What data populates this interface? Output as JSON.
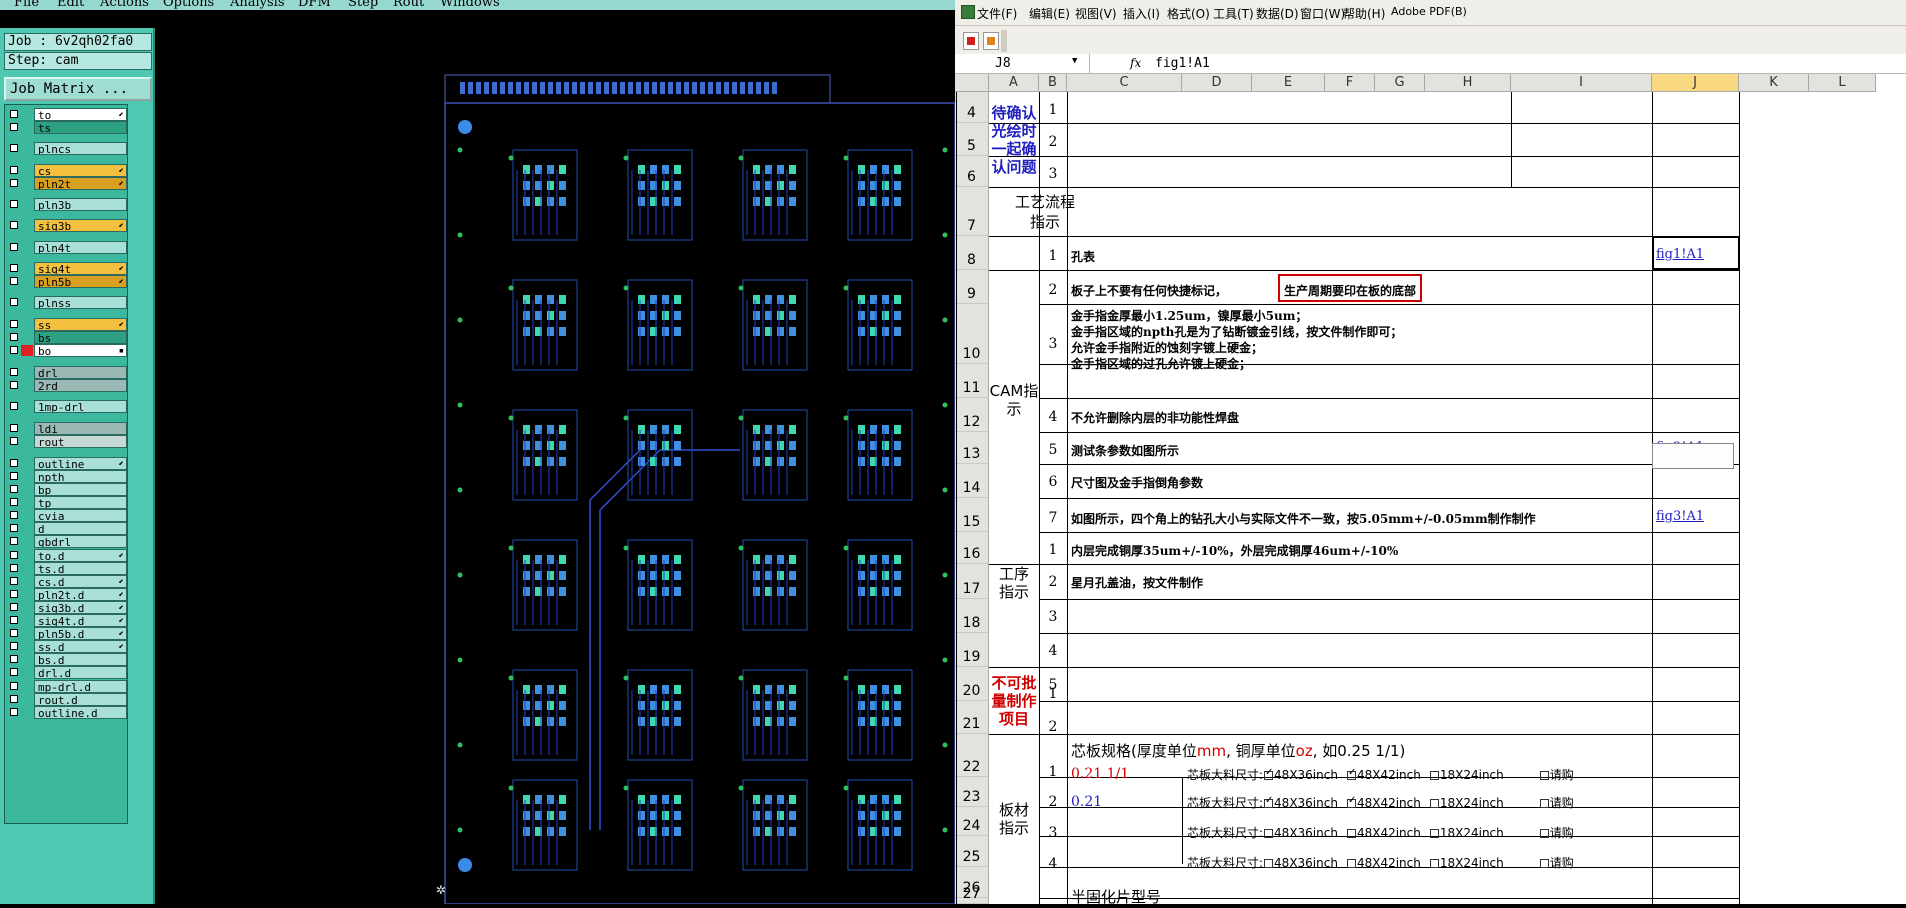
{
  "cam": {
    "menu": [
      "File",
      "Edit",
      "Actions",
      "Options",
      "Analysis",
      "DFM",
      "Step",
      "Rout",
      "Windows"
    ],
    "job_label": "Job : 6v2qh02fa0",
    "step_label": "Step: cam",
    "job_matrix_button": "Job Matrix ...",
    "layers": [
      {
        "name": "to",
        "color": "#ffffff",
        "edit": "⬋"
      },
      {
        "name": "ts",
        "color": "#2ca080",
        "edit": ""
      },
      {
        "name": "plncs",
        "color": "#a8e0d8",
        "edit": ""
      },
      {
        "name": "cs",
        "color": "#f4c040",
        "edit": "⬋"
      },
      {
        "name": "pln2t",
        "color": "#d8a020",
        "edit": "⬋"
      },
      {
        "name": "pln3b",
        "color": "#a8e0d8",
        "edit": ""
      },
      {
        "name": "sig3b",
        "color": "#f4c040",
        "edit": "⬋"
      },
      {
        "name": "pln4t",
        "color": "#a8e0d8",
        "edit": ""
      },
      {
        "name": "sig4t",
        "color": "#f4c040",
        "edit": "⬋"
      },
      {
        "name": "pln5b",
        "color": "#d8a020",
        "edit": "⬋"
      },
      {
        "name": "plnss",
        "color": "#a8e0d8",
        "edit": ""
      },
      {
        "name": "ss",
        "color": "#f4c040",
        "edit": "⬋"
      },
      {
        "name": "bs",
        "color": "#2ca080",
        "edit": ""
      },
      {
        "name": "bo",
        "color": "#ffffff",
        "edit": "▪"
      },
      {
        "name": "drl",
        "color": "#9ab8b4",
        "edit": ""
      },
      {
        "name": "2rd",
        "color": "#9ab8b4",
        "edit": ""
      },
      {
        "name": "1mp-drl",
        "color": "#a8e0d8",
        "edit": ""
      },
      {
        "name": "ldi",
        "color": "#9ab8b4",
        "edit": ""
      },
      {
        "name": "rout",
        "color": "#c8d8d4",
        "edit": ""
      },
      {
        "name": "outline",
        "color": "#a8e0d8",
        "edit": "⬋"
      },
      {
        "name": "npth",
        "color": "#a8e0d8",
        "edit": ""
      },
      {
        "name": "bp",
        "color": "#a8e0d8",
        "edit": ""
      },
      {
        "name": "tp",
        "color": "#a8e0d8",
        "edit": ""
      },
      {
        "name": "cvia",
        "color": "#a8e0d8",
        "edit": ""
      },
      {
        "name": "d",
        "color": "#a8e0d8",
        "edit": ""
      },
      {
        "name": "gbdrl",
        "color": "#a8e0d8",
        "edit": ""
      },
      {
        "name": "to.d",
        "color": "#a8e0d8",
        "edit": "⬋"
      },
      {
        "name": "ts.d",
        "color": "#a8e0d8",
        "edit": ""
      },
      {
        "name": "cs.d",
        "color": "#a8e0d8",
        "edit": "⬋"
      },
      {
        "name": "pln2t.d",
        "color": "#a8e0d8",
        "edit": "⬋"
      },
      {
        "name": "sig3b.d",
        "color": "#a8e0d8",
        "edit": "⬋"
      },
      {
        "name": "sig4t.d",
        "color": "#a8e0d8",
        "edit": "⬋"
      },
      {
        "name": "pln5b.d",
        "color": "#a8e0d8",
        "edit": "⬋"
      },
      {
        "name": "ss.d",
        "color": "#a8e0d8",
        "edit": "⬋"
      },
      {
        "name": "bs.d",
        "color": "#a8e0d8",
        "edit": ""
      },
      {
        "name": "drl.d",
        "color": "#a8e0d8",
        "edit": ""
      },
      {
        "name": "mp-drl.d",
        "color": "#a8e0d8",
        "edit": ""
      },
      {
        "name": "rout.d",
        "color": "#a8e0d8",
        "edit": ""
      },
      {
        "name": "outline.d",
        "color": "#a8e0d8",
        "edit": ""
      }
    ]
  },
  "excel": {
    "menu": [
      "文件(F)",
      "编辑(E)",
      "视图(V)",
      "插入(I)",
      "格式(O)",
      "工具(T)",
      "数据(D)",
      "窗口(W)",
      "帮助(H)",
      "Adobe PDF(B)"
    ],
    "name_box": "J8",
    "fx": "fx",
    "formula": "fig1!A1",
    "columns": [
      "A",
      "B",
      "C",
      "D",
      "E",
      "F",
      "G",
      "H",
      "I",
      "J",
      "K",
      "L"
    ],
    "rows": [
      "4",
      "5",
      "6",
      "7",
      "8",
      "9",
      "10",
      "11",
      "12",
      "13",
      "14",
      "15",
      "16",
      "17",
      "18",
      "19",
      "20",
      "21",
      "22",
      "23",
      "24",
      "25",
      "26",
      "27"
    ],
    "sections": {
      "confirm": "待确认光绘时一起确认问题",
      "process": "工艺流程指示",
      "cam": "CAM指示",
      "procedure": "工序指示",
      "no_batch": "不可批量制作项目",
      "board": "板材指示"
    },
    "numbers": {
      "confirm": [
        "1",
        "2",
        "3"
      ],
      "cam": [
        "1",
        "2",
        "3",
        "4",
        "5",
        "6",
        "7"
      ],
      "procedure": [
        "1",
        "2",
        "3",
        "4",
        "5"
      ],
      "no_batch": [
        "1",
        "2"
      ],
      "board": [
        "1",
        "2",
        "3",
        "4"
      ]
    },
    "cam_items": [
      "孔表",
      "板子上不要有任何快捷标记，",
      "金手指金厚最小1.25um，镍厚最小5um；",
      "不允许删除内层的非功能性焊盘",
      "测试条参数如图所示",
      "尺寸图及金手指倒角参数",
      "如图所示，四个角上的钻孔大小与实际文件不一致，按5.05mm+/-0.05mm制作制作"
    ],
    "cam_item2_highlight": "生产周期要印在板的底部",
    "cam_item3_lines": [
      "金手指区域的npth孔是为了钻断镀金引线，按文件制作即可；",
      "允许金手指附近的蚀刻字镀上硬金；",
      "金手指区域的过孔允许镀上硬金；"
    ],
    "links": {
      "r8": "fig1!A1",
      "r12": "fig2!A1",
      "r14": "fig3!A1"
    },
    "procedure_items": [
      "内层完成铜厚35um+/-10%，外层完成铜厚46um+/-10%",
      "星月孔盖油，按文件制作"
    ],
    "core_spec": {
      "prefix": "芯板规格(厚度单位",
      "u1": "mm",
      "mid": ", 铜厚单位",
      "u2": "oz",
      "suffix": ", 如0.25 1/1)"
    },
    "board_values": [
      "0.21 1/1",
      "0.21",
      "",
      ""
    ],
    "core_size_label": "芯板大料尺寸:",
    "size_options": [
      "48X36inch",
      "48X42inch",
      "18X24inch"
    ],
    "purchase_label": "请购",
    "board_checks": [
      [
        true,
        true,
        false,
        false
      ],
      [
        true,
        true,
        false,
        false
      ],
      [
        false,
        false,
        false,
        false
      ],
      [
        false,
        false,
        false,
        false
      ]
    ],
    "prepreg_label": "半固化片型号"
  }
}
